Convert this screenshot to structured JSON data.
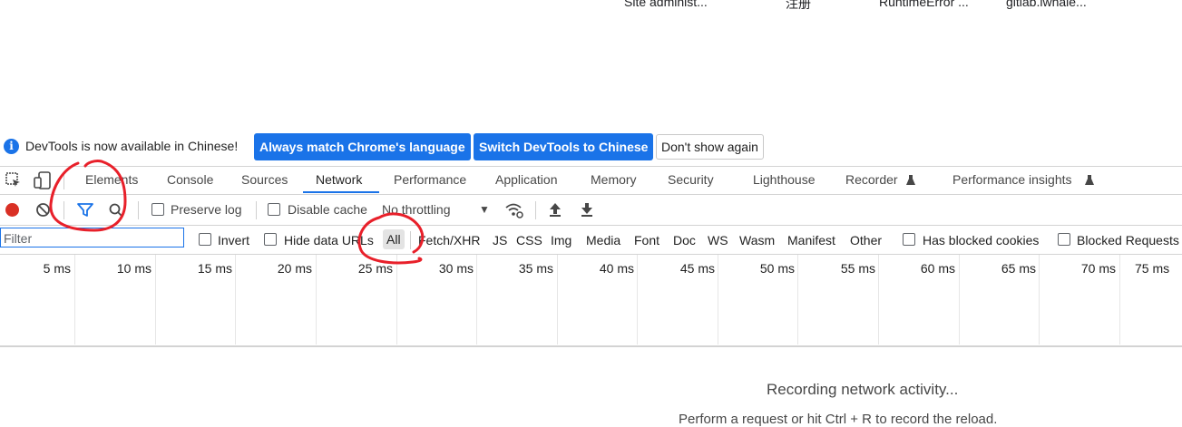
{
  "page": {
    "shortcuts": [
      "Site administ...",
      "注册",
      "RuntimeError ...",
      "gitlab.iwhale..."
    ]
  },
  "infobar": {
    "message": "DevTools is now available in Chinese!",
    "btn_match": "Always match Chrome's language",
    "btn_switch": "Switch DevTools to Chinese",
    "btn_dont_show": "Don't show again"
  },
  "tabs": [
    "Elements",
    "Console",
    "Sources",
    "Network",
    "Performance",
    "Application",
    "Memory",
    "Security",
    "Lighthouse",
    "Recorder",
    "Performance insights"
  ],
  "active_tab": "Network",
  "toolbar": {
    "preserve_log": "Preserve log",
    "disable_cache": "Disable cache",
    "throttling": "No throttling"
  },
  "filterbar": {
    "placeholder": "Filter",
    "invert": "Invert",
    "hide_data_urls": "Hide data URLs",
    "types": [
      "All",
      "Fetch/XHR",
      "JS",
      "CSS",
      "Img",
      "Media",
      "Font",
      "Doc",
      "WS",
      "Wasm",
      "Manifest",
      "Other"
    ],
    "has_blocked_cookies": "Has blocked cookies",
    "blocked_requests": "Blocked Requests"
  },
  "timeline": {
    "ticks": [
      "5 ms",
      "10 ms",
      "15 ms",
      "20 ms",
      "25 ms",
      "30 ms",
      "35 ms",
      "40 ms",
      "45 ms",
      "50 ms",
      "55 ms",
      "60 ms",
      "65 ms",
      "70 ms",
      "75 ms"
    ]
  },
  "empty_state": {
    "title": "Recording network activity...",
    "hint": "Perform a request or hit Ctrl + R to record the reload."
  },
  "colors": {
    "accent": "#1a73e8",
    "record": "#d93025",
    "annotation": "#e8202a"
  }
}
